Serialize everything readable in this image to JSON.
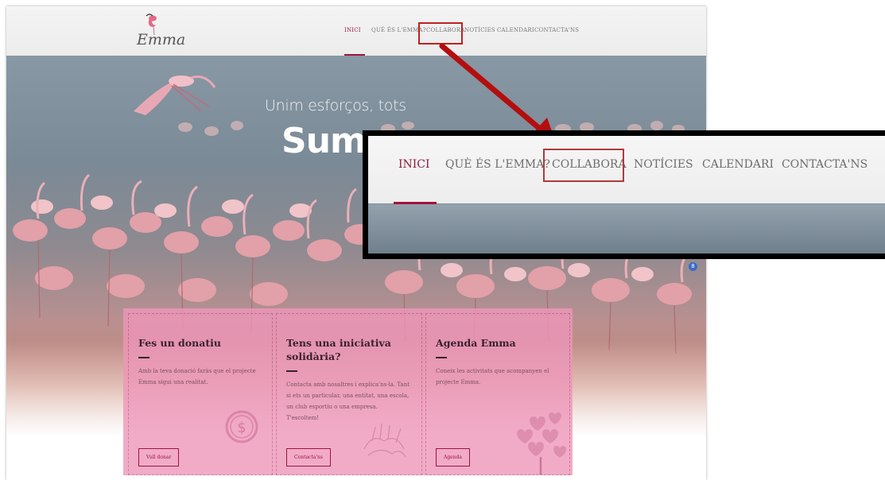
{
  "brand": {
    "logo_text": "Emma"
  },
  "nav": {
    "items": [
      {
        "label": "INICI",
        "active": true
      },
      {
        "label": "QUÈ ÉS L'EMMA?",
        "active": false
      },
      {
        "label": "COLLABORA",
        "active": false
      },
      {
        "label": "NOTÍCIES",
        "active": false
      },
      {
        "label": "CALENDARI",
        "active": false
      },
      {
        "label": "CONTACTA'NS",
        "active": false
      }
    ]
  },
  "hero": {
    "line1": "Unim esforços, tots",
    "line2": "Sum"
  },
  "scroll_badge": "8",
  "cards": [
    {
      "title": "Fes un donatiu",
      "text": "Amb la teva donació faràs que el projecte Emma sigui una realitat.",
      "button": "Vull donar",
      "icon": "dollar-coin-icon"
    },
    {
      "title": "Tens una iniciativa solidària?",
      "text": "Contacta amb nosaltres i explica'ns-la. Tant si ets un particular, una entitat, una escola, un club esportiu o una empresa. T'escoltem!",
      "button": "Contacta'ns",
      "icon": "hands-icon"
    },
    {
      "title": "Agenda Emma",
      "text": "Coneix les activitats que acompanyen el projecte Emma.",
      "button": "Agenda",
      "icon": "hearts-tree-icon"
    }
  ],
  "colors": {
    "accent": "#a0143c",
    "highlight": "#c02020",
    "card_bg": "#ee96b9"
  }
}
